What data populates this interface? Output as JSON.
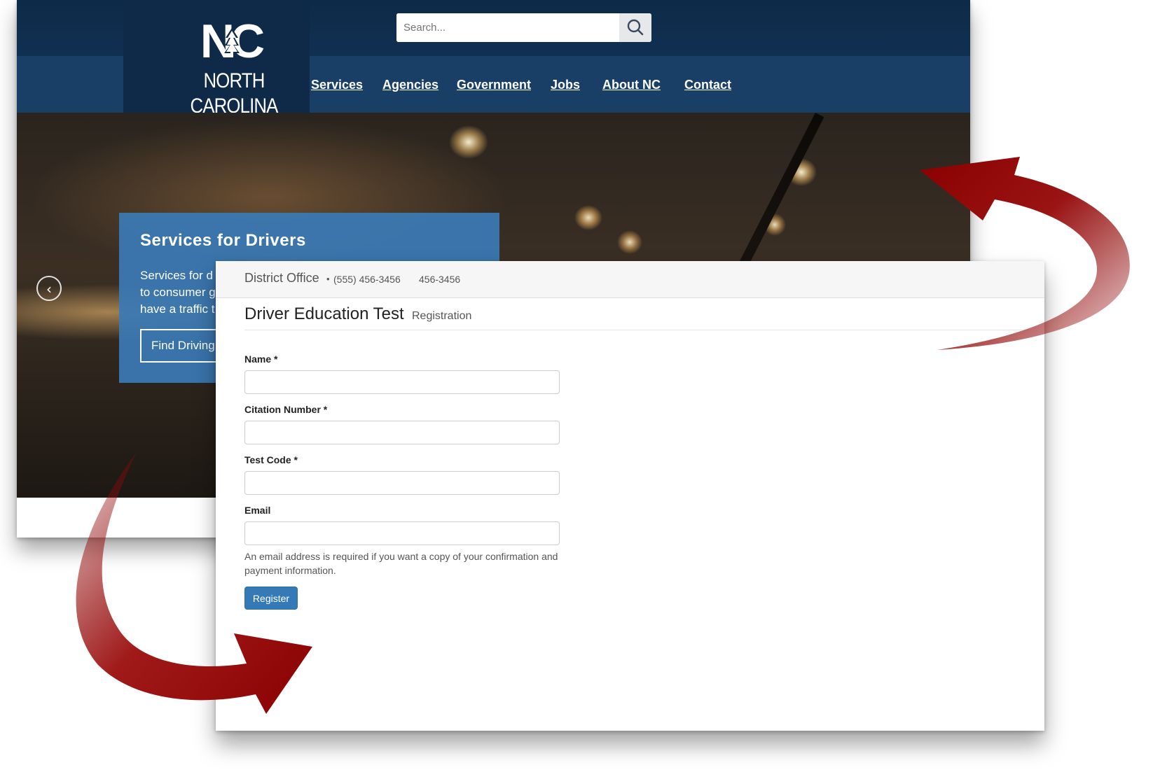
{
  "nc_site": {
    "logo": {
      "mark": "NC",
      "name": "NORTH CAROLINA"
    },
    "search": {
      "placeholder": "Search..."
    },
    "nav": [
      "Services",
      "Agencies",
      "Government",
      "Jobs",
      "About NC",
      "Contact"
    ],
    "hero": {
      "title": "Services for Drivers",
      "body": "Services for d\nto consumer g\nhave a traffic t",
      "button_label": "Find Driving",
      "prev_label": "‹"
    }
  },
  "registration": {
    "office": {
      "name": "District Office",
      "bullet": "•",
      "phone": "(555) 456-3456",
      "phone_short": "456-3456"
    },
    "title": "Driver Education Test",
    "subtitle": "Registration",
    "fields": [
      {
        "label": "Name *",
        "value": ""
      },
      {
        "label": "Citation Number *",
        "value": ""
      },
      {
        "label": "Test Code *",
        "value": ""
      },
      {
        "label": "Email",
        "value": ""
      }
    ],
    "email_help": "An email address is required if you want a copy of your confirmation and payment information.",
    "submit_label": "Register"
  },
  "colors": {
    "nc_header": "#13365b",
    "promo_panel": "#3a7ab5",
    "primary_button": "#337ab7",
    "arrow": "#8b0000"
  },
  "icons": [
    "search-icon",
    "chevron-left-icon",
    "curved-arrow-icon"
  ]
}
